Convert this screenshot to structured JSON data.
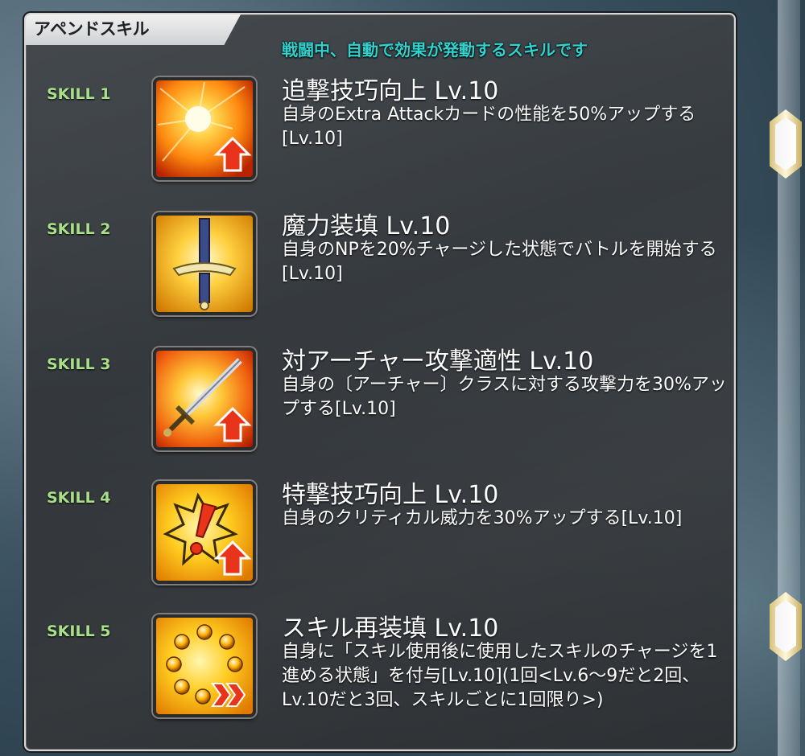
{
  "panel": {
    "tab_title": "アペンドスキル",
    "header_note": "戦闘中、自動で効果が発動するスキルです"
  },
  "skills": [
    {
      "label": "SKILL 1",
      "name": "追撃技巧向上 Lv.10",
      "desc": "自身のExtra Attackカードの性能を50%アップする[Lv.10]",
      "icon": "burst-with-up-arrow-icon"
    },
    {
      "label": "SKILL 2",
      "name": "魔力装填 Lv.10",
      "desc": "自身のNPを20%チャージした状態でバトルを開始する[Lv.10]",
      "icon": "sword-icon"
    },
    {
      "label": "SKILL 3",
      "name": "対アーチャー攻撃適性 Lv.10",
      "desc": "自身の〔アーチャー〕クラスに対する攻撃力を30%アップする[Lv.10]",
      "icon": "sword-with-up-arrow-icon"
    },
    {
      "label": "SKILL 4",
      "name": "特撃技巧向上 Lv.10",
      "desc": "自身のクリティカル威力を30%アップする[Lv.10]",
      "icon": "exclamation-with-up-arrow-icon"
    },
    {
      "label": "SKILL 5",
      "name": "スキル再装填 Lv.10",
      "desc": "自身に「スキル使用後に使用したスキルのチャージを1進める状態」を付与[Lv.10](1回<Lv.6〜9だと2回、Lv.10だと3回、スキルごとに1回限り>)",
      "icon": "orbs-with-chevrons-icon"
    }
  ],
  "colors": {
    "skill_label": "#a8e08a",
    "header_note": "#2fd3cf",
    "panel_border": "#d8d8d8"
  }
}
